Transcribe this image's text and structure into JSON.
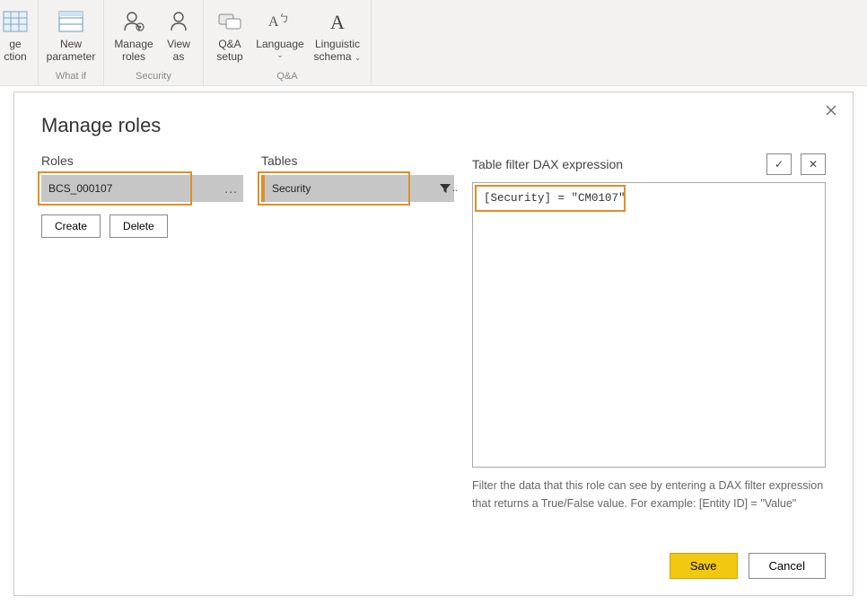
{
  "ribbon": {
    "partial_btn": {
      "line1": "ge",
      "line2": "ction"
    },
    "new_parameter": {
      "line1": "New",
      "line2": "parameter"
    },
    "manage_roles": {
      "line1": "Manage",
      "line2": "roles"
    },
    "view_as": {
      "line1": "View",
      "line2": "as"
    },
    "qa_setup": {
      "line1": "Q&A",
      "line2": "setup"
    },
    "language": {
      "label": "Language"
    },
    "linguistic": {
      "line1": "Linguistic",
      "line2": "schema"
    },
    "groups": {
      "whatif": "What if",
      "security": "Security",
      "qa": "Q&A"
    }
  },
  "dialog": {
    "title": "Manage roles",
    "roles_header": "Roles",
    "tables_header": "Tables",
    "dax_header": "Table filter DAX expression",
    "role_name": "BCS_000107",
    "table_name": "Security",
    "dax_expression": "[Security] = \"CM0107\"",
    "create": "Create",
    "delete": "Delete",
    "help_text": "Filter the data that this role can see by entering a DAX filter expression that returns a True/False value. For example: [Entity ID] = \"Value\"",
    "ellipsis": "...",
    "check": "✓",
    "cross": "✕",
    "save": "Save",
    "cancel": "Cancel"
  }
}
